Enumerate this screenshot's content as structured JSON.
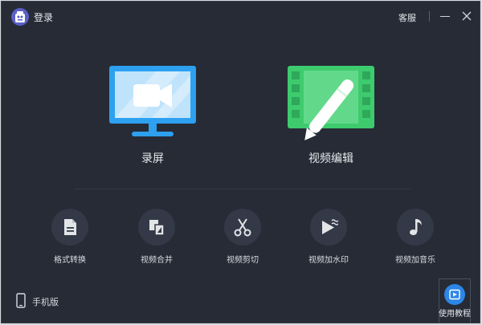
{
  "titlebar": {
    "login_label": "登录",
    "support_label": "客服",
    "avatar_icon": "robot-avatar-icon",
    "minimize_icon": "minimize-icon",
    "close_icon": "close-icon"
  },
  "main": {
    "record": {
      "label": "录屏",
      "icon": "monitor-camera-icon"
    },
    "edit": {
      "label": "视频编辑",
      "icon": "film-pen-icon"
    }
  },
  "tools": [
    {
      "label": "格式转换",
      "icon": "document-convert-icon"
    },
    {
      "label": "视频合并",
      "icon": "merge-icon"
    },
    {
      "label": "视频剪切",
      "icon": "scissors-icon"
    },
    {
      "label": "视频加水印",
      "icon": "play-watermark-icon"
    },
    {
      "label": "视频加音乐",
      "icon": "music-note-icon"
    }
  ],
  "footer": {
    "mobile_label": "手机版",
    "tutorial_label": "使用教程"
  },
  "colors": {
    "background": "#262b36",
    "record_tile": "#2ea0f0",
    "edit_tile": "#3ecb6e",
    "tool_circle": "#333946",
    "accent_blue": "#2d86e6"
  }
}
